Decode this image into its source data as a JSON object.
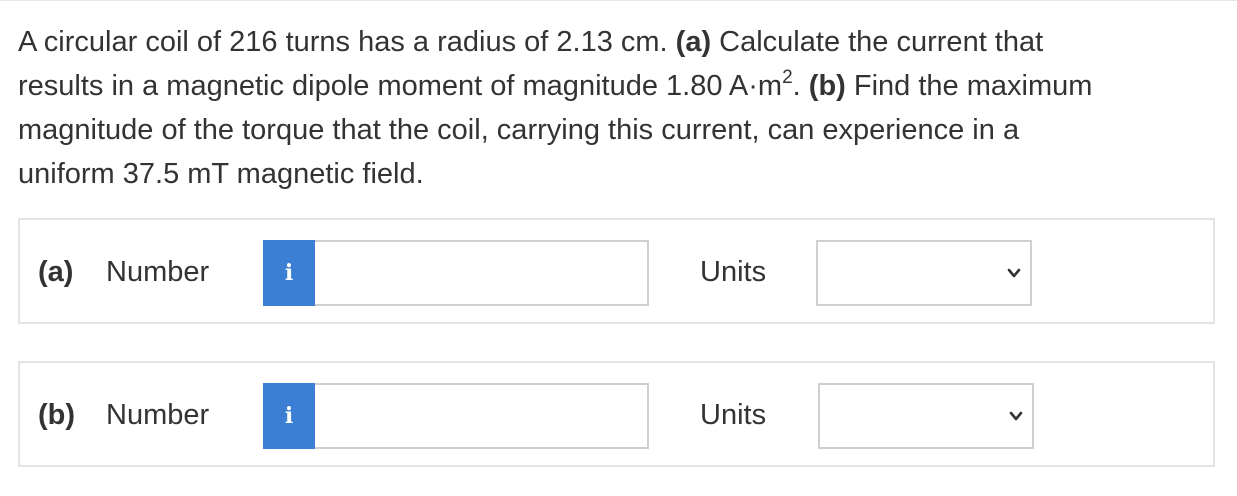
{
  "question": {
    "line1_a": "A circular coil of 216 turns has a radius of 2.13 cm. ",
    "line1_a_tag": "(a)",
    "line1_b": " Calculate the current that",
    "line2_a": "results in a magnetic dipole moment of magnitude 1.80 A·m",
    "line2_sup": "2",
    "line2_b": ". ",
    "line2_b_tag": "(b)",
    "line2_c": " Find the maximum",
    "line3": "magnitude of the torque that the coil, carrying this current, can experience in a",
    "line4": "uniform 37.5 mT magnetic field."
  },
  "parts": [
    {
      "tag": "(a)",
      "number_label": "Number",
      "info_icon": "i",
      "number_value": "",
      "units_label": "Units",
      "units_selected": ""
    },
    {
      "tag": "(b)",
      "number_label": "Number",
      "info_icon": "i",
      "number_value": "",
      "units_label": "Units",
      "units_selected": ""
    }
  ],
  "icons": {
    "info": "info-icon",
    "dropdown": "chevron-down-icon"
  },
  "colors": {
    "info_button": "#3b7fd4",
    "text": "#333333",
    "border": "#e3e3e3"
  }
}
